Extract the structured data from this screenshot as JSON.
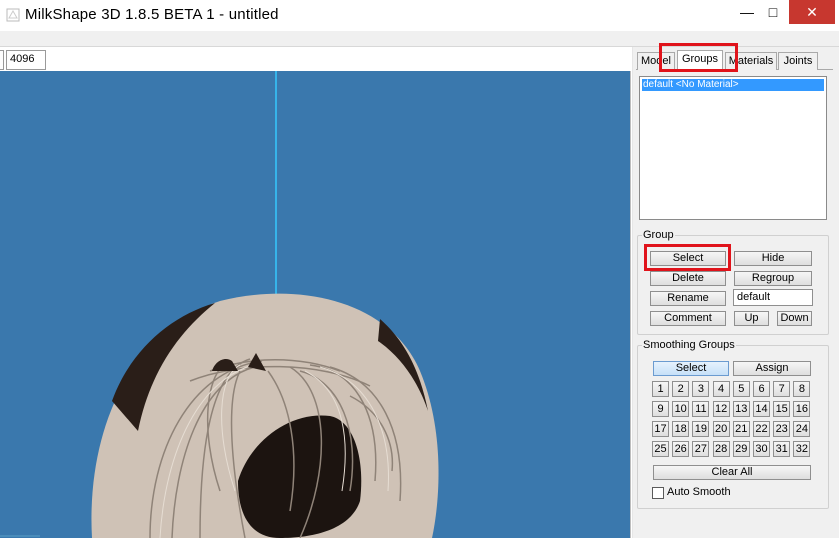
{
  "window": {
    "title": "MilkShape 3D 1.8.5 BETA 1 - untitled",
    "minimize": "—",
    "maximize": "□",
    "close": "✕"
  },
  "toolbar": {
    "field_value": "4096"
  },
  "tabs": [
    {
      "label": "Model",
      "active": false
    },
    {
      "label": "Groups",
      "active": true
    },
    {
      "label": "Materials",
      "active": false
    },
    {
      "label": "Joints",
      "active": false
    }
  ],
  "group_list": {
    "items": [
      "default <No Material>"
    ],
    "selected_index": 0
  },
  "group_section": {
    "legend": "Group",
    "select": "Select",
    "hide": "Hide",
    "delete": "Delete",
    "regroup": "Regroup",
    "rename": "Rename",
    "rename_value": "default",
    "comment": "Comment",
    "up": "Up",
    "down": "Down"
  },
  "smoothing_section": {
    "legend": "Smoothing Groups",
    "select": "Select",
    "assign": "Assign",
    "numbers": [
      "1",
      "2",
      "3",
      "4",
      "5",
      "6",
      "7",
      "8",
      "9",
      "10",
      "11",
      "12",
      "13",
      "14",
      "15",
      "16",
      "17",
      "18",
      "19",
      "20",
      "21",
      "22",
      "23",
      "24",
      "25",
      "26",
      "27",
      "28",
      "29",
      "30",
      "31",
      "32"
    ],
    "clear_all": "Clear All",
    "auto_smooth": "Auto Smooth",
    "auto_smooth_checked": false
  },
  "colors": {
    "viewport_bg": "#3a78ad",
    "axis_line": "#34c8ff",
    "model_fill": "#cfc2b6",
    "model_shadow": "#2a1e18",
    "highlight": "#e0131b",
    "selection": "#3399ff"
  },
  "annotations": [
    "groups-tab-highlight",
    "select-button-highlight"
  ]
}
